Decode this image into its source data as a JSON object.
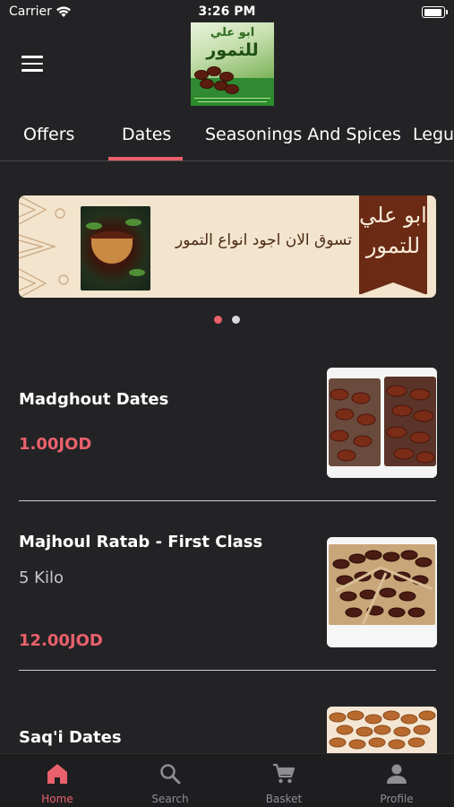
{
  "status_bar": {
    "carrier": "Carrier",
    "time": "3:26 PM"
  },
  "header": {
    "logo_line1": "ابو علي",
    "logo_line2": "للتمور"
  },
  "tabs": [
    {
      "label": "Offers"
    },
    {
      "label": "Dates",
      "selected": true
    },
    {
      "label": "Seasonings And Spices"
    },
    {
      "label": "Legumes"
    }
  ],
  "banner": {
    "text": "تسوق الان اجود انواع التمور",
    "ribbon_line1": "ابو علي",
    "ribbon_line2": "للتمور"
  },
  "carousel": {
    "page_count": 2,
    "active_index": 0
  },
  "products": [
    {
      "name": "Madghout Dates",
      "subtitle": "",
      "price": "1.00JOD"
    },
    {
      "name": "Majhoul Ratab - First Class",
      "subtitle": "5 Kilo",
      "price": "12.00JOD"
    },
    {
      "name": "Saq'i Dates",
      "subtitle": "",
      "price": ""
    }
  ],
  "bottom_nav": [
    {
      "label": "Home",
      "icon": "home-icon",
      "active": true
    },
    {
      "label": "Search",
      "icon": "search-icon",
      "active": false
    },
    {
      "label": "Basket",
      "icon": "cart-icon",
      "active": false
    },
    {
      "label": "Profile",
      "icon": "person-icon",
      "active": false
    }
  ],
  "colors": {
    "accent": "#e9616c",
    "background": "#232325",
    "inactive_nav": "#8e8e93"
  }
}
